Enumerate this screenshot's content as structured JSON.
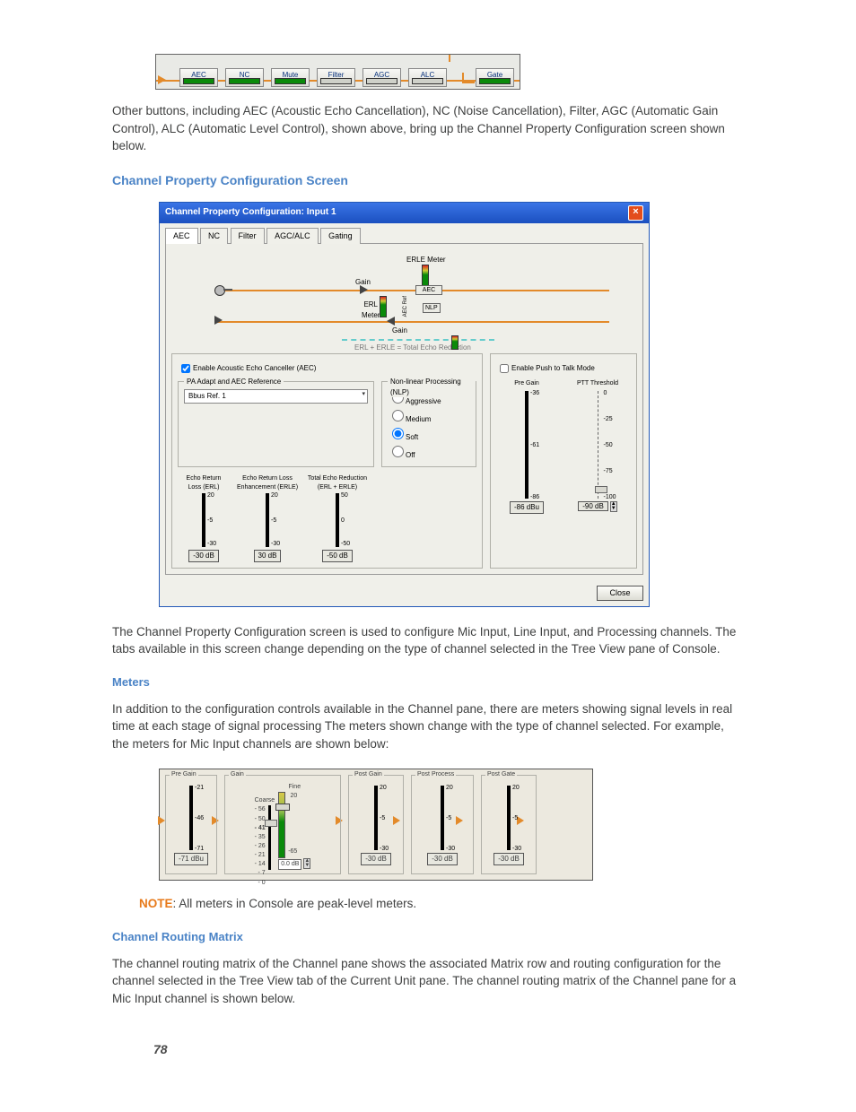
{
  "chain": {
    "buttons": [
      "AEC",
      "NC",
      "Mute",
      "Filter",
      "AGC",
      "ALC",
      "Gate"
    ],
    "disabled_indexes": [
      3,
      4,
      5
    ]
  },
  "intro_para": "Other buttons, including AEC (Acoustic Echo Cancellation), NC (Noise Cancellation), Filter, AGC (Automatic Gain Control), ALC (Automatic Level Control), shown above, bring up the Channel Property Configuration screen shown below.",
  "h_config": "Channel Property Configuration Screen",
  "config": {
    "title": "Channel Property Configuration: Input 1",
    "tabs": [
      "AEC",
      "NC",
      "Filter",
      "AGC/ALC",
      "Gating"
    ],
    "diagram_labels": {
      "erle_meter": "ERLE Meter",
      "aec": "AEC",
      "erl_meter": "ERL\nMeter",
      "nlp": "NLP",
      "gain1": "Gain",
      "gain2": "Gain",
      "ter": "ERL + ERLE = Total Echo Reduction",
      "aec_ref": "AEC Ref"
    },
    "enable_aec": "Enable Acoustic Echo Canceller (AEC)",
    "nlp_title": "Non-linear Processing (NLP)",
    "nlp_opts": [
      "Aggressive",
      "Medium",
      "Soft",
      "Off"
    ],
    "ref_title": "PA Adapt and AEC Reference",
    "ref_value": "Bbus Ref. 1",
    "enable_ptt": "Enable Push to Talk Mode",
    "pre_gain_label": "Pre Gain",
    "ptt_threshold_label": "PTT Threshold",
    "meters_row": [
      {
        "title": "Echo Return\nLoss (ERL)",
        "ticks": [
          "20",
          "-5",
          "-30"
        ],
        "val": "-30 dB"
      },
      {
        "title": "Echo Return Loss\nEnhancement (ERLE)",
        "ticks": [
          "20",
          "-5",
          "-30"
        ],
        "val": "30 dB"
      },
      {
        "title": "Total Echo Reduction\n(ERL + ERLE)",
        "ticks": [
          "50",
          "0",
          "-50"
        ],
        "val": "-50 dB"
      }
    ],
    "pregain": {
      "ticks": [
        "-36",
        "-61",
        "-86"
      ],
      "val": "-86 dBu"
    },
    "ptt": {
      "ticks": [
        "0",
        "-25",
        "-50",
        "-75",
        "-100"
      ],
      "val": "-90 dB"
    },
    "close": "Close"
  },
  "para_config": "The Channel Property Configuration screen is used to configure Mic Input, Line Input, and Processing channels. The tabs available in this screen change depending on the type of channel selected in the Tree View pane of Console.",
  "h_meters": "Meters",
  "para_meters": "In addition to the configuration controls available in the Channel pane, there are meters showing signal levels in real time at each stage of signal processing The meters shown change with the type of channel selected. For example, the meters for Mic Input channels are shown below:",
  "meters_fig": {
    "pre_gain": {
      "label": "Pre Gain",
      "ticks": [
        "-21",
        "-46",
        "-71"
      ],
      "val": "-71 dBu"
    },
    "gain": {
      "label": "Gain",
      "coarse_label": "Coarse",
      "fine_label": "Fine",
      "coarse_ticks": [
        "- 56",
        "- 50",
        "- 41",
        "- 35",
        "- 26",
        "- 21",
        "- 14",
        "- 7",
        "- 0"
      ],
      "fine_ticks": [
        "20",
        "-65"
      ],
      "fine_val": "0.0 dB"
    },
    "post_gain": {
      "label": "Post Gain",
      "ticks": [
        "20",
        "-5",
        "-30"
      ],
      "val": "-30 dB"
    },
    "post_process": {
      "label": "Post Process",
      "ticks": [
        "20",
        "-5",
        "-30"
      ],
      "val": "-30 dB"
    },
    "post_gate": {
      "label": "Post Gate",
      "ticks": [
        "20",
        "-5",
        "-30"
      ],
      "val": "-30 dB"
    }
  },
  "note_label": "NOTE",
  "note_text": ": All meters in Console are peak-level meters.",
  "h_routing": "Channel Routing Matrix",
  "para_routing": "The channel routing matrix of the Channel pane shows the associated Matrix row and routing configuration for the channel selected in the Tree View tab of the Current Unit pane. The channel routing matrix of the Channel pane for a Mic Input channel is shown below.",
  "page": "78"
}
